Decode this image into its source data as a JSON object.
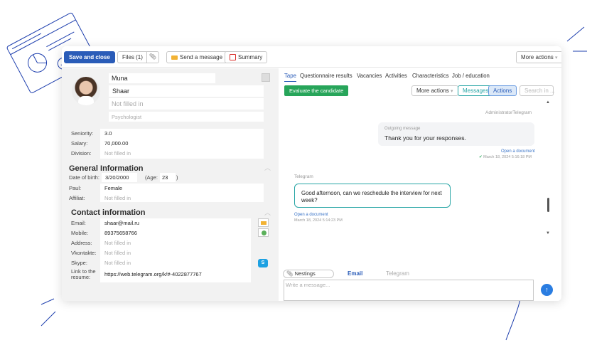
{
  "toolbar": {
    "save_close": "Save and close",
    "files": "Files (1)",
    "send_message": "Send a message",
    "summary": "Summary",
    "more_actions": "More actions"
  },
  "profile": {
    "first_name": "Muna",
    "last_name": "Shaar",
    "middle_name_placeholder": "Not filled in",
    "position": "Psychologist"
  },
  "details": {
    "seniority_label": "Seniority:",
    "seniority_value": "3.0",
    "salary_label": "Salary:",
    "salary_value": "70,000.00",
    "division_label": "Division:",
    "division_value": "Not filled in"
  },
  "general": {
    "title": "General Information",
    "dob_label": "Date of birth:",
    "dob_value": "3/20/2000",
    "age_label": "(Age:",
    "age_value": "23",
    "age_close": ")",
    "paul_label": "Paul:",
    "paul_value": "Female",
    "affiliat_label": "Affiliat:",
    "affiliat_value": "Not filled in"
  },
  "contact": {
    "title": "Contact information",
    "email_label": "Email:",
    "email_value": "shaar@mail.ru",
    "mobile_label": "Mobile:",
    "mobile_value": "89375658766",
    "address_label": "Address:",
    "address_value": "Not filled in",
    "vk_label": "Vkontakte:",
    "vk_value": "Not filled in",
    "skype_label": "Skype:",
    "skype_value": "Not filled in",
    "resume_label_1": "Link to the",
    "resume_label_2": "resume:",
    "resume_value": "https://web.telegram.org/k/#-4022877767"
  },
  "tabs": [
    "Tape",
    "Questionnaire results",
    "Vacancies",
    "Activities",
    "Characteristics",
    "Job / education"
  ],
  "feed": {
    "evaluate": "Evaluate the candidate",
    "more_actions": "More actions",
    "messages": "Messages",
    "actions": "Actions",
    "search_placeholder": "Search in ...",
    "sender_top": "AdministratorTelegram",
    "outgoing_label": "Outgoing message",
    "outgoing_text": "Thank you for your responses.",
    "open_doc_1": "Open a document",
    "time_1": "March 18, 2024 5:16:18 PM",
    "incoming_sender": "Telegram",
    "incoming_text_1": "Good afternoon, can we reschedule the interview for next",
    "incoming_text_2": "week?",
    "open_doc_2": "Open a document",
    "time_2": "March 18, 2024 5:14:23 PM"
  },
  "composer": {
    "nestings": "Nestings",
    "email": "Email",
    "telegram": "Telegram",
    "placeholder": "Write a message..."
  },
  "colors": {
    "primary": "#2a5cb8",
    "accent_green": "#27a55a",
    "teal": "#27a5a5",
    "decor": "#1e3fae"
  }
}
